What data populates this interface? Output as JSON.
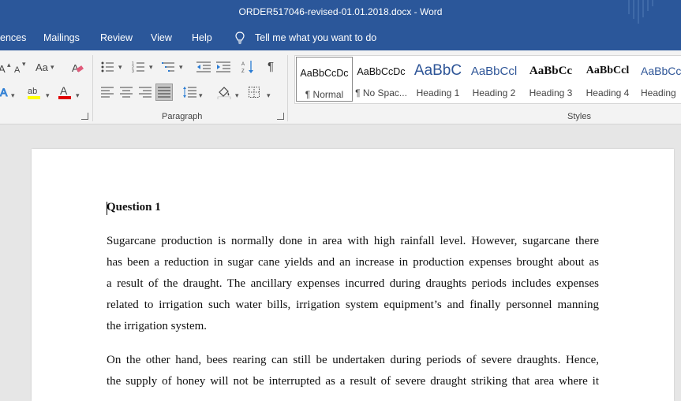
{
  "titlebar": {
    "title": "ORDER517046-revised-01.01.2018.docx  -  Word"
  },
  "tabs": [
    {
      "label": "ences"
    },
    {
      "label": "Mailings"
    },
    {
      "label": "Review"
    },
    {
      "label": "View"
    },
    {
      "label": "Help"
    }
  ],
  "tell_me": {
    "label": "Tell me what you want to do"
  },
  "ribbon": {
    "font_group": {
      "case_label": "Aa",
      "grow_label": "A",
      "shrink_label": "A"
    },
    "paragraph_group": {
      "label": "Paragraph"
    },
    "styles_group": {
      "label": "Styles",
      "items": [
        {
          "preview": "AaBbCcDc",
          "name": "¶ Normal",
          "selected": true
        },
        {
          "preview": "AaBbCcDc",
          "name": "¶ No Spac..."
        },
        {
          "preview": "AaBbC",
          "name": "Heading 1"
        },
        {
          "preview": "AaBbCcl",
          "name": "Heading 2"
        },
        {
          "preview": "AaBbCc",
          "name": "Heading 3"
        },
        {
          "preview": "AaBbCcl",
          "name": "Heading 4"
        },
        {
          "preview": "AaBbCcl",
          "name": "Heading"
        }
      ]
    }
  },
  "document": {
    "heading": "Question 1",
    "paragraphs": [
      {
        "lines": [
          "Sugarcane production is normally done in area with high rainfall level. However, sugarcane there",
          "has been a reduction in sugar cane yields and an increase in production expenses brought about as",
          "a result of the draught. The ancillary expenses incurred during draughts periods includes expenses",
          "related to irrigation such water bills, irrigation system equipment’s and finally personnel manning",
          "the irrigation system."
        ]
      },
      {
        "lines": [
          "On the other hand, bees rearing can still be undertaken during periods of severe draughts. Hence,",
          "the supply of honey will not be interrupted as a result of severe draught striking that area where it"
        ]
      }
    ]
  },
  "colors": {
    "titlebar_bg": "#2b579a",
    "ribbon_bg": "#f3f3f3",
    "highlight_yellow": "#ffff00",
    "font_color_red": "#e00000",
    "heading_blue": "#2e5597"
  }
}
